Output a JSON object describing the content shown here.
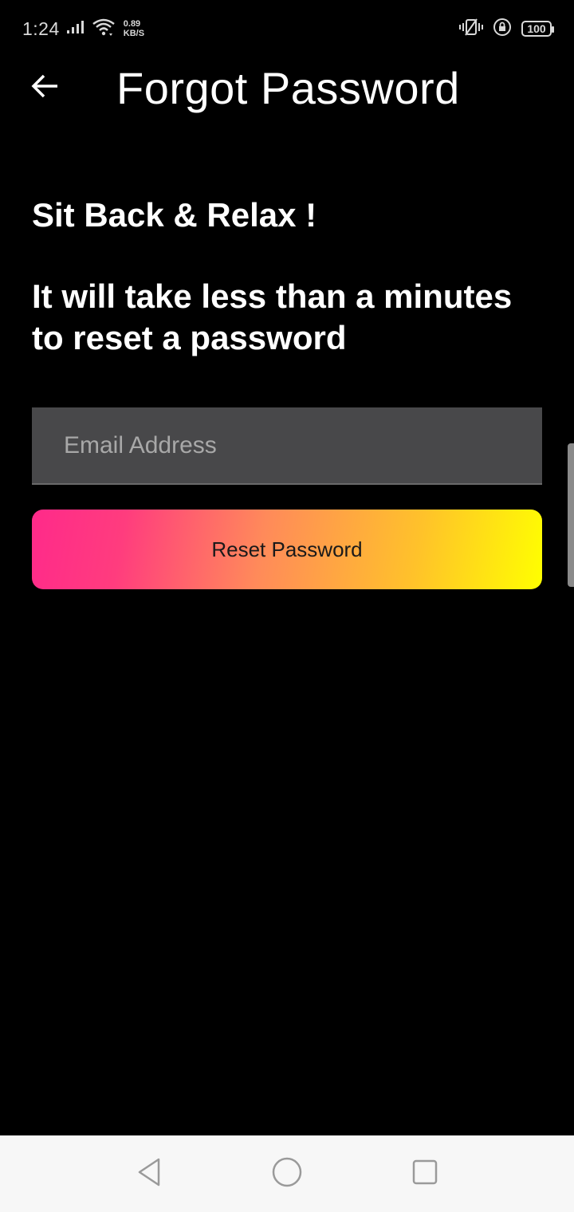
{
  "status_bar": {
    "time": "1:24",
    "net_speed_value": "0.89",
    "net_speed_unit": "KB/S",
    "battery": "100",
    "icons": [
      "signal-icon",
      "wifi-icon",
      "vibrate-icon",
      "rotation-lock-icon",
      "battery-icon"
    ]
  },
  "app_bar": {
    "title": "Forgot Password",
    "back_icon": "arrow-left-icon"
  },
  "content": {
    "headline": "Sit Back & Relax !",
    "subline": "It will take less than a minutes to reset a password"
  },
  "form": {
    "email": {
      "placeholder": "Email Address",
      "value": ""
    },
    "reset_button_label": "Reset Password"
  },
  "colors": {
    "background": "#000000",
    "field_background": "#48484a",
    "button_gradient": [
      "#ff2a8a",
      "#ff8a5a",
      "#ffff00"
    ],
    "nav_bar": "#f7f7f7"
  },
  "nav_bar": {
    "icons": [
      "back-triangle-icon",
      "home-circle-icon",
      "recents-square-icon"
    ]
  }
}
